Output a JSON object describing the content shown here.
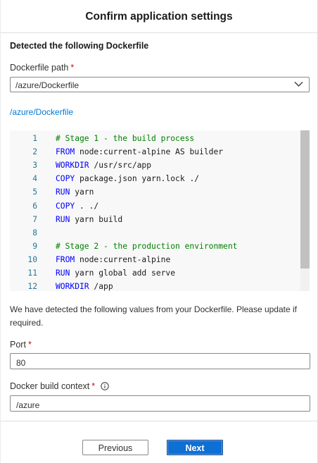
{
  "dialog": {
    "title": "Confirm application settings",
    "section_heading": "Detected the following Dockerfile"
  },
  "dockerfile_path": {
    "label": "Dockerfile path",
    "required_mark": "*",
    "selected_value": "/azure/Dockerfile",
    "link_text": "/azure/Dockerfile"
  },
  "code_view": {
    "lines": [
      {
        "num": "1",
        "keyword": "",
        "rest": "# Stage 1 - the build process",
        "is_comment": true
      },
      {
        "num": "2",
        "keyword": "FROM",
        "rest": " node:current-alpine AS builder",
        "is_comment": false
      },
      {
        "num": "3",
        "keyword": "WORKDIR",
        "rest": " /usr/src/app",
        "is_comment": false
      },
      {
        "num": "4",
        "keyword": "COPY",
        "rest": " package.json yarn.lock ./",
        "is_comment": false
      },
      {
        "num": "5",
        "keyword": "RUN",
        "rest": " yarn",
        "is_comment": false
      },
      {
        "num": "6",
        "keyword": "COPY",
        "rest": " . ./",
        "is_comment": false
      },
      {
        "num": "7",
        "keyword": "RUN",
        "rest": " yarn build",
        "is_comment": false
      },
      {
        "num": "8",
        "keyword": "",
        "rest": "",
        "is_comment": false
      },
      {
        "num": "9",
        "keyword": "",
        "rest": "# Stage 2 - the production environment",
        "is_comment": true
      },
      {
        "num": "10",
        "keyword": "FROM",
        "rest": " node:current-alpine",
        "is_comment": false
      },
      {
        "num": "11",
        "keyword": "RUN",
        "rest": " yarn global add serve",
        "is_comment": false
      },
      {
        "num": "12",
        "keyword": "WORKDIR",
        "rest": " /app",
        "is_comment": false
      }
    ],
    "colors": {
      "keyword": "#0000ff",
      "comment": "#008000",
      "line_number": "#237893"
    }
  },
  "description": "We have detected the following values from your Dockerfile. Please update if required.",
  "port": {
    "label": "Port",
    "required_mark": "*",
    "value": "80"
  },
  "build_context": {
    "label": "Docker build context",
    "required_mark": "*",
    "info_icon": "info-icon",
    "value": "/azure"
  },
  "footer": {
    "previous_label": "Previous",
    "next_label": "Next"
  },
  "accent_color": "#0078d4"
}
